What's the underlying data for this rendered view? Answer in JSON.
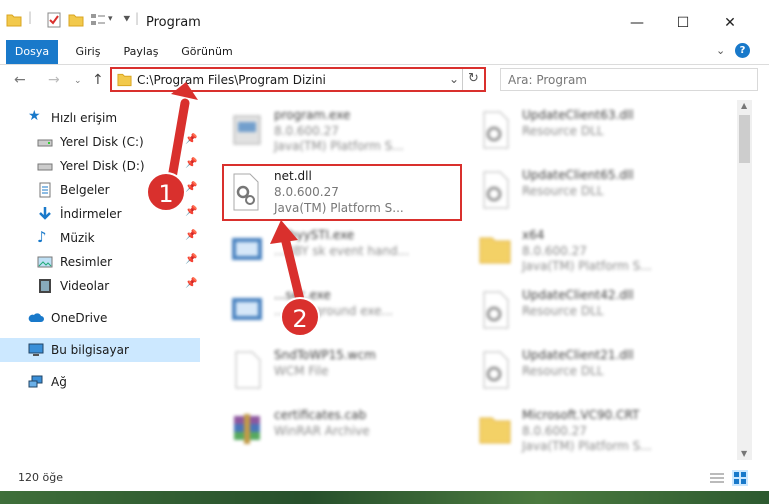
{
  "window": {
    "title": "Program"
  },
  "ribbon": {
    "tabs": [
      "Dosya",
      "Giriş",
      "Paylaş",
      "Görünüm"
    ]
  },
  "address": {
    "path": "C:\\Program Files\\Program Dizini"
  },
  "search": {
    "placeholder": "Ara: Program"
  },
  "sidebar": {
    "items": [
      {
        "label": "Hızlı erişim",
        "icon": "star-icon",
        "pinned": false
      },
      {
        "label": "Yerel Disk (C:)",
        "icon": "drive-icon",
        "pinned": true
      },
      {
        "label": "Yerel Disk (D:)",
        "icon": "drive-icon",
        "pinned": true
      },
      {
        "label": "Belgeler",
        "icon": "documents-icon",
        "pinned": true
      },
      {
        "label": "İndirmeler",
        "icon": "download-icon",
        "pinned": true
      },
      {
        "label": "Müzik",
        "icon": "music-icon",
        "pinned": true
      },
      {
        "label": "Resimler",
        "icon": "pictures-icon",
        "pinned": true
      },
      {
        "label": "Videolar",
        "icon": "video-icon",
        "pinned": true
      },
      {
        "label": "OneDrive",
        "icon": "cloud-icon",
        "pinned": false
      },
      {
        "label": "Bu bilgisayar",
        "icon": "computer-icon",
        "pinned": false
      },
      {
        "label": "Ağ",
        "icon": "network-icon",
        "pinned": false
      }
    ]
  },
  "files": [
    {
      "name": "program.exe",
      "type": "8.0.600.27",
      "desc": "Java(TM) Platform S...",
      "icon": "exe-icon"
    },
    {
      "name": "UpdateClient63.dll",
      "type": "Resource DLL",
      "desc": "",
      "icon": "dll-icon"
    },
    {
      "name": "net.dll",
      "type": "8.0.600.27",
      "desc": "Java(TM) Platform S...",
      "icon": "dll-icon"
    },
    {
      "name": "UpdateClient65.dll",
      "type": "Resource DLL",
      "desc": "",
      "icon": "dll-icon"
    },
    {
      "name": "...lbyySTI.exe",
      "type": "...BBY sk event hand...",
      "desc": "",
      "icon": "exe-icon"
    },
    {
      "name": "x64",
      "type": "8.0.600.27",
      "desc": "Java(TM) Platform S...",
      "icon": "folder-icon"
    },
    {
      "name": "...sec.exe",
      "type": "...background exe...",
      "desc": "",
      "icon": "exe-icon"
    },
    {
      "name": "UpdateClient42.dll",
      "type": "Resource DLL",
      "desc": "",
      "icon": "dll-icon"
    },
    {
      "name": "SndToWP15.wcm",
      "type": "WCM File",
      "desc": "",
      "icon": "file-icon"
    },
    {
      "name": "UpdateClient21.dll",
      "type": "Resource DLL",
      "desc": "",
      "icon": "dll-icon"
    },
    {
      "name": "certificates.cab",
      "type": "WinRAR Archive",
      "desc": "",
      "icon": "archive-icon"
    },
    {
      "name": "Microsoft.VC90.CRT",
      "type": "8.0.600.27",
      "desc": "Java(TM) Platform S...",
      "icon": "folder-icon"
    }
  ],
  "status": {
    "count": "120 öğe"
  },
  "annotations": [
    "1",
    "2"
  ],
  "colors": {
    "accent": "#1979ca",
    "highlight": "#d9302d",
    "selected": "#cce8ff"
  }
}
